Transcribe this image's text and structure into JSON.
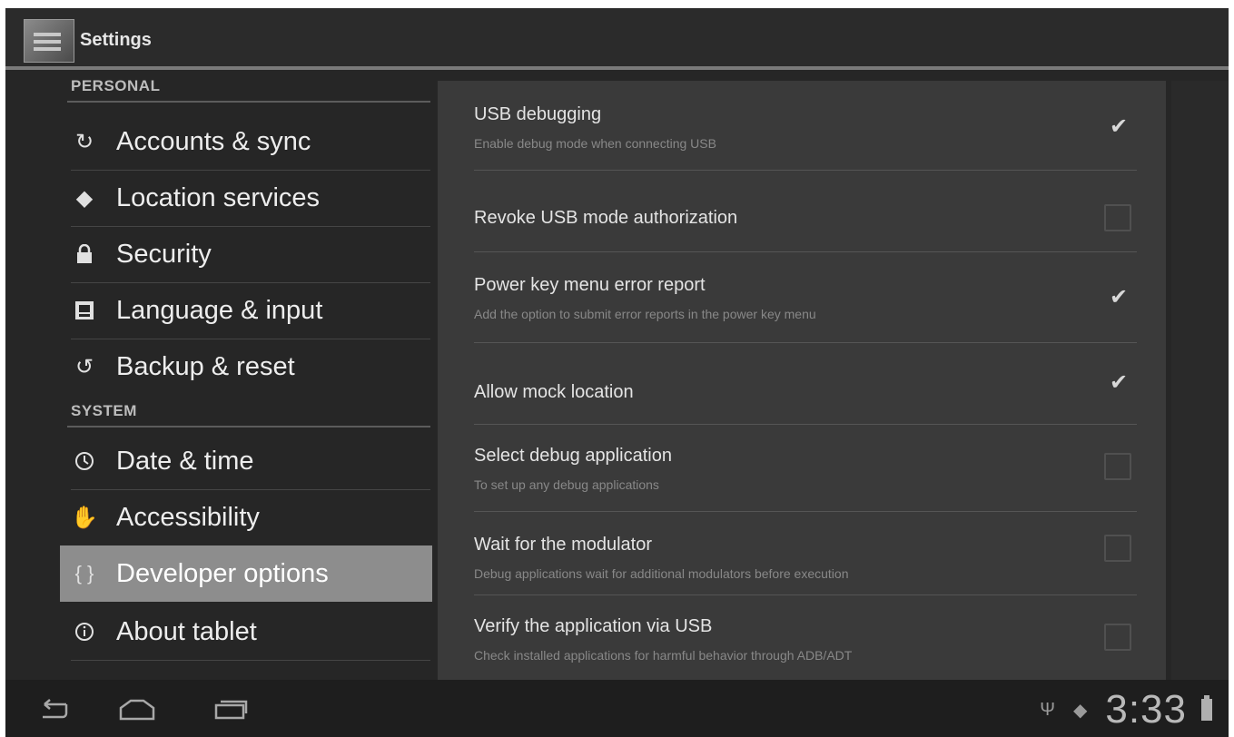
{
  "app": {
    "title": "Settings"
  },
  "sidebar": {
    "sections": [
      {
        "header": "PERSONAL",
        "items": [
          {
            "label": "Accounts & sync",
            "icon": "sync-icon"
          },
          {
            "label": "Location services",
            "icon": "location-icon"
          },
          {
            "label": "Security",
            "icon": "lock-icon"
          },
          {
            "label": "Language & input",
            "icon": "keyboard-icon"
          },
          {
            "label": "Backup & reset",
            "icon": "backup-icon"
          }
        ]
      },
      {
        "header": "SYSTEM",
        "items": [
          {
            "label": "Date & time",
            "icon": "clock-icon"
          },
          {
            "label": "Accessibility",
            "icon": "accessibility-icon"
          },
          {
            "label": "Developer options",
            "icon": "braces-icon",
            "selected": true
          },
          {
            "label": "About tablet",
            "icon": "info-icon"
          }
        ]
      }
    ]
  },
  "developer_options": {
    "prefs": [
      {
        "title": "USB debugging",
        "summary": "Enable debug mode when connecting USB",
        "checked": true
      },
      {
        "title": "Revoke USB mode authorization",
        "summary": "",
        "checked": false
      },
      {
        "title": "Power key menu error report",
        "summary": "Add the option to submit error reports in the power key menu",
        "checked": true
      },
      {
        "title": "Allow mock location",
        "summary": "",
        "checked": true
      },
      {
        "title": "Select debug application",
        "summary": "To set up any debug applications",
        "checked": false
      },
      {
        "title": "Wait for the modulator",
        "summary": "Debug applications wait for additional modulators before execution",
        "checked": false
      },
      {
        "title": "Verify the application via USB",
        "summary": "Check installed applications for harmful behavior through ADB/ADT",
        "checked": false
      }
    ]
  },
  "system_bar": {
    "clock": "3:33"
  },
  "colors": {
    "selected_item": "#8d8d8d",
    "background": "#262626",
    "content_pane": "#3a3a3a"
  }
}
